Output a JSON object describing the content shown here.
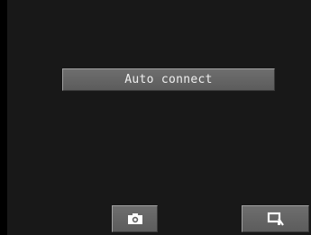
{
  "main": {
    "auto_connect_label": "Auto connect"
  },
  "toolbar": {
    "camera_icon": "camera-icon",
    "image_view_icon": "image-search-icon"
  },
  "colors": {
    "background": "#181818",
    "button": "#666666",
    "text": "#ffffff"
  }
}
